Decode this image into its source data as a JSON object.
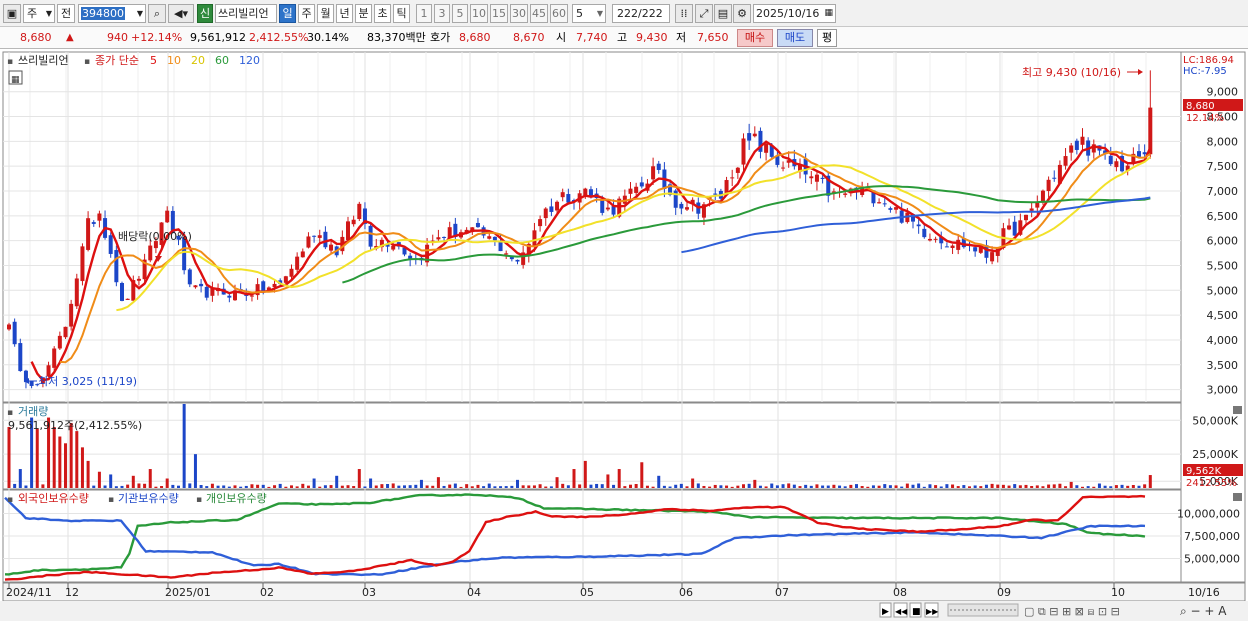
{
  "toolbar": {
    "market_label": "주",
    "prev_label": "전",
    "code_value": "394800",
    "badge_new": "신",
    "stock_name": "쓰리빌리언",
    "periods": [
      "일",
      "주",
      "월",
      "년",
      "분",
      "초",
      "틱"
    ],
    "active_period": "일",
    "intervals": [
      "1",
      "3",
      "5",
      "10",
      "15",
      "30",
      "45",
      "60"
    ],
    "interval_value": "5",
    "count_current": "222",
    "count_total": "/222",
    "date_value": "2025/10/16"
  },
  "quote": {
    "price": "8,680",
    "direction": "▲",
    "change": "940",
    "change_pct": "+12.14%",
    "volume": "9,561,912",
    "volume_ratio": "2,412.55%",
    "turnover": "30.14%",
    "amount": "83,370백만",
    "bid_label": "호가",
    "ask_price": "8,680",
    "bid_price": "8,670",
    "open_label": "시",
    "open": "7,740",
    "high_label": "고",
    "high": "9,430",
    "low_label": "저",
    "low": "7,650",
    "buy_label": "매수",
    "sell_label": "매도",
    "avg_label": "평"
  },
  "price_panel": {
    "stock_name": "쓰리빌리언",
    "indicator_label": "종가 단순",
    "ma_periods": [
      "5",
      "10",
      "20",
      "60",
      "120"
    ],
    "lc_label": "LC:186.94",
    "hc_label": "HC:-7.95",
    "last_price_tag": "8,680",
    "last_pct_tag": "12.14%",
    "max_annotation": "최고 9,430 (10/16)",
    "min_annotation": "최저 3,025 (11/19)",
    "dividend_annotation": "배당락(0.00%)"
  },
  "volume_panel": {
    "title": "거래량",
    "info": "9,561,912주(2,412.55%)",
    "last_tag": "9,562K",
    "last_pct_tag": "2412.55%"
  },
  "holding_panel": {
    "foreign_label": "외국인보유수량",
    "institution_label": "기관보유수량",
    "individual_label": "개인보유수량"
  },
  "xaxis": {
    "labels": [
      "2024/11",
      "12",
      "2025/01",
      "02",
      "03",
      "04",
      "05",
      "06",
      "07",
      "08",
      "09",
      "10"
    ],
    "right_label": "10/16"
  },
  "colors": {
    "up": "#d01818",
    "down": "#1c46c8",
    "ma5": "#dd1010",
    "ma10": "#f08c18",
    "ma20": "#f2e12a",
    "ma60": "#2a9a3a",
    "ma120": "#2f5fd8",
    "foreign": "#dd1010",
    "institution": "#2f5fd8",
    "individual": "#2a9a3a"
  },
  "chart_data": {
    "type": "candlestick",
    "x_months": [
      "2024/11",
      "12",
      "2025/01",
      "02",
      "03",
      "04",
      "05",
      "06",
      "07",
      "08",
      "09",
      "10"
    ],
    "price_ylim": [
      2750,
      9800
    ],
    "price_ticks": [
      3000,
      3500,
      4000,
      4500,
      5000,
      5500,
      6000,
      6500,
      7000,
      7500,
      8000,
      8500,
      9000
    ],
    "close_trajectory": [
      [
        0,
        4400
      ],
      [
        2,
        3300
      ],
      [
        4,
        3150
      ],
      [
        6,
        3200
      ],
      [
        10,
        4300
      ],
      [
        14,
        6300
      ],
      [
        16,
        6600
      ],
      [
        18,
        5800
      ],
      [
        20,
        4700
      ],
      [
        24,
        5500
      ],
      [
        28,
        6600
      ],
      [
        30,
        5900
      ],
      [
        32,
        5000
      ],
      [
        36,
        4950
      ],
      [
        42,
        4950
      ],
      [
        48,
        5100
      ],
      [
        54,
        6200
      ],
      [
        58,
        5800
      ],
      [
        62,
        6700
      ],
      [
        64,
        6000
      ],
      [
        68,
        6000
      ],
      [
        72,
        5600
      ],
      [
        76,
        6100
      ],
      [
        80,
        6200
      ],
      [
        84,
        6100
      ],
      [
        88,
        5800
      ],
      [
        90,
        5500
      ],
      [
        94,
        6500
      ],
      [
        98,
        6900
      ],
      [
        102,
        7000
      ],
      [
        106,
        6600
      ],
      [
        110,
        6900
      ],
      [
        114,
        7400
      ],
      [
        118,
        6800
      ],
      [
        122,
        6700
      ],
      [
        126,
        6900
      ],
      [
        130,
        7900
      ],
      [
        132,
        8000
      ],
      [
        136,
        7600
      ],
      [
        140,
        7400
      ],
      [
        144,
        7100
      ],
      [
        146,
        6900
      ],
      [
        150,
        7000
      ],
      [
        154,
        6900
      ],
      [
        158,
        6500
      ],
      [
        162,
        6200
      ],
      [
        166,
        6000
      ],
      [
        170,
        5900
      ],
      [
        173,
        5700
      ],
      [
        176,
        6100
      ],
      [
        180,
        6400
      ],
      [
        184,
        7200
      ],
      [
        188,
        7800
      ],
      [
        190,
        8000
      ],
      [
        194,
        7600
      ],
      [
        198,
        7500
      ],
      [
        200,
        7700
      ],
      [
        201,
        7740
      ],
      [
        202,
        8680
      ]
    ],
    "last_candle": {
      "date": "10/16",
      "open": 7740,
      "high": 9430,
      "low": 7650,
      "close": 8680
    },
    "max": {
      "value": 9430,
      "date": "10/16"
    },
    "min": {
      "value": 3025,
      "date": "11/19"
    },
    "volume": {
      "unit": "K",
      "ticks": [
        5000,
        25000,
        50000
      ],
      "ylim": [
        0,
        62000
      ],
      "spikes": [
        [
          0,
          45000
        ],
        [
          2,
          14000
        ],
        [
          4,
          52000
        ],
        [
          5,
          44000
        ],
        [
          7,
          52000
        ],
        [
          8,
          45000
        ],
        [
          9,
          38000
        ],
        [
          10,
          33000
        ],
        [
          11,
          48000
        ],
        [
          12,
          42000
        ],
        [
          13,
          30000
        ],
        [
          14,
          20000
        ],
        [
          16,
          12000
        ],
        [
          18,
          10000
        ],
        [
          22,
          9000
        ],
        [
          25,
          14000
        ],
        [
          28,
          7000
        ],
        [
          31,
          62000
        ],
        [
          33,
          25000
        ],
        [
          54,
          7000
        ],
        [
          58,
          9000
        ],
        [
          62,
          14000
        ],
        [
          64,
          7000
        ],
        [
          73,
          6000
        ],
        [
          76,
          8000
        ],
        [
          90,
          6000
        ],
        [
          97,
          8000
        ],
        [
          100,
          14000
        ],
        [
          102,
          20000
        ],
        [
          106,
          10000
        ],
        [
          108,
          14000
        ],
        [
          112,
          19000
        ],
        [
          115,
          9000
        ],
        [
          121,
          7000
        ],
        [
          132,
          6000
        ],
        [
          188,
          4500
        ],
        [
          202,
          9562
        ]
      ],
      "last": 9562
    },
    "holdings": {
      "ylim": [
        2500000,
        12500000
      ],
      "ticks": [
        5000000,
        7500000,
        10000000
      ],
      "foreign": [
        [
          0,
          2600000
        ],
        [
          10,
          3100000
        ],
        [
          20,
          3500000
        ],
        [
          30,
          3200000
        ],
        [
          40,
          2900000
        ],
        [
          50,
          3400000
        ],
        [
          62,
          3800000
        ],
        [
          66,
          4000000
        ],
        [
          74,
          3300000
        ],
        [
          84,
          3600000
        ],
        [
          98,
          4800000
        ],
        [
          104,
          4200000
        ],
        [
          108,
          4700000
        ],
        [
          112,
          5800000
        ],
        [
          116,
          9000000
        ],
        [
          120,
          9500000
        ],
        [
          128,
          10200000
        ],
        [
          132,
          9700000
        ],
        [
          140,
          9600000
        ],
        [
          150,
          9900000
        ],
        [
          160,
          10500000
        ],
        [
          170,
          10300000
        ],
        [
          180,
          10700000
        ],
        [
          188,
          10700000
        ],
        [
          196,
          9000000
        ],
        [
          202,
          8500000
        ],
        [
          210,
          8200000
        ],
        [
          220,
          8000000
        ],
        [
          230,
          8200000
        ],
        [
          240,
          8600000
        ],
        [
          248,
          9300000
        ],
        [
          254,
          9200000
        ],
        [
          260,
          11800000
        ],
        [
          275,
          11900000
        ]
      ],
      "institution": [
        [
          0,
          11800000
        ],
        [
          5,
          9500000
        ],
        [
          15,
          9200000
        ],
        [
          28,
          9200000
        ],
        [
          34,
          5800000
        ],
        [
          50,
          5700000
        ],
        [
          60,
          4200000
        ],
        [
          66,
          4400000
        ],
        [
          75,
          3300000
        ],
        [
          90,
          3200000
        ],
        [
          100,
          4000000
        ],
        [
          110,
          4700000
        ],
        [
          120,
          5100000
        ],
        [
          140,
          5200000
        ],
        [
          168,
          5500000
        ],
        [
          176,
          7300000
        ],
        [
          190,
          7600000
        ],
        [
          210,
          7800000
        ],
        [
          220,
          7900000
        ],
        [
          240,
          7500000
        ],
        [
          250,
          7300000
        ],
        [
          262,
          8600000
        ],
        [
          275,
          8600000
        ]
      ],
      "individual": [
        [
          0,
          3200000
        ],
        [
          8,
          3700000
        ],
        [
          20,
          3800000
        ],
        [
          28,
          4000000
        ],
        [
          30,
          5500000
        ],
        [
          32,
          8600000
        ],
        [
          40,
          9000000
        ],
        [
          56,
          9300000
        ],
        [
          66,
          11100000
        ],
        [
          78,
          11000000
        ],
        [
          88,
          11200000
        ],
        [
          100,
          12000000
        ],
        [
          114,
          12100000
        ],
        [
          124,
          11700000
        ],
        [
          130,
          10600000
        ],
        [
          150,
          10400000
        ],
        [
          170,
          10200000
        ],
        [
          180,
          9600000
        ],
        [
          200,
          9500000
        ],
        [
          220,
          9500000
        ],
        [
          240,
          9500000
        ],
        [
          256,
          8800000
        ],
        [
          262,
          7800000
        ],
        [
          275,
          7500000
        ]
      ]
    }
  }
}
